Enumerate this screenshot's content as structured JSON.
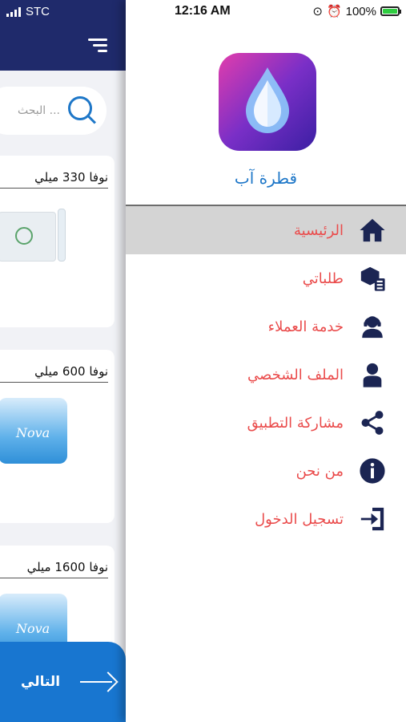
{
  "status_bar": {
    "carrier": "STC",
    "time": "12:16 AM",
    "battery": "100%"
  },
  "main_screen": {
    "search": {
      "placeholder": "البحث ..."
    },
    "products": [
      {
        "name": "نوفا 330 ميلي"
      },
      {
        "name": "نوفا 600 ميلي",
        "brand": "Nova"
      },
      {
        "name": "نوفا 1600 ميلي",
        "brand": "Nova"
      }
    ],
    "next_label": "التالي"
  },
  "drawer": {
    "app_name": "قطرة آب",
    "menu": [
      {
        "label": "الرئيسية",
        "icon": "home-icon",
        "active": true
      },
      {
        "label": "طلباتي",
        "icon": "orders-icon",
        "active": false
      },
      {
        "label": "خدمة العملاء",
        "icon": "customer-service-icon",
        "active": false
      },
      {
        "label": "الملف الشخصي",
        "icon": "profile-icon",
        "active": false
      },
      {
        "label": "مشاركة التطبيق",
        "icon": "share-icon",
        "active": false
      },
      {
        "label": "من نحن",
        "icon": "info-icon",
        "active": false
      },
      {
        "label": "تسجيل الدخول",
        "icon": "login-icon",
        "active": false
      }
    ]
  },
  "colors": {
    "header": "#1f2a6b",
    "accent": "#1876d0",
    "menu_text": "#ea4c4c",
    "icon": "#1b2553"
  }
}
